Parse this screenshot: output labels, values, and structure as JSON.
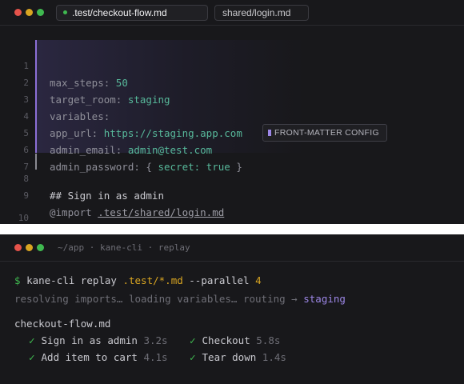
{
  "editor": {
    "tabs": {
      "active": ".test/checkout-flow.md",
      "inactive": "shared/login.md"
    },
    "badge_label": "FRONT-MATTER CONFIG",
    "lines": [
      {
        "n": "1",
        "key": "max_steps:",
        "value": "50"
      },
      {
        "n": "2",
        "key": "target_room:",
        "value": "staging"
      },
      {
        "n": "3",
        "key": "variables:",
        "value": ""
      },
      {
        "n": "4",
        "key": "app_url:",
        "value": "https://staging.app.com"
      },
      {
        "n": "5",
        "key": "admin_email:",
        "value": "admin@test.com"
      },
      {
        "n": "6",
        "key": "admin_password:",
        "brace_open": "{",
        "subkey": "secret:",
        "value": "true",
        "brace_close": "}"
      },
      {
        "n": "7"
      },
      {
        "n": "8",
        "text": "## Sign in as admin"
      },
      {
        "n": "9",
        "keyword": "@import",
        "link": ".test/shared/login.md"
      },
      {
        "n": "10"
      }
    ]
  },
  "terminal": {
    "title": "~/app · kane-cli · replay",
    "command": {
      "prompt": "$",
      "cmd": "kane-cli replay",
      "glob": ".test/*.md",
      "flag": "--parallel",
      "count": "4"
    },
    "status": {
      "text": "resolving imports… loading variables… routing →",
      "target": "staging"
    },
    "file": "checkout-flow.md",
    "results": [
      {
        "check": "✓",
        "name": "Sign in as admin",
        "time": "3.2s"
      },
      {
        "check": "✓",
        "name": "Checkout",
        "time": "5.8s"
      },
      {
        "check": "✓",
        "name": "Add item to cart",
        "time": "4.1s"
      },
      {
        "check": "✓",
        "name": "Tear down",
        "time": "1.4s"
      }
    ]
  },
  "colors": {
    "accent_purple": "#9c86e6",
    "success_green": "#3fb950",
    "value_teal": "#57b89a",
    "warning_yellow": "#d9a521"
  }
}
